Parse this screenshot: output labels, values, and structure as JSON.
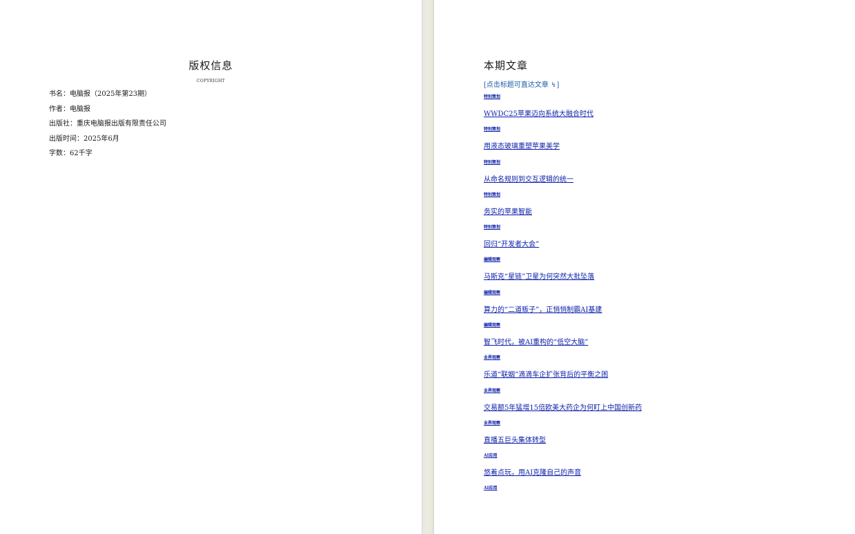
{
  "left_page": {
    "title": "版权信息",
    "subtitle": "COPYRIGHT",
    "info": [
      "书名：电脑报（2025年第23期）",
      "作者：电脑报",
      "出版社：重庆电脑报出版有限责任公司",
      "出版时间：2025年6月",
      "字数：62千字"
    ]
  },
  "right_page": {
    "title": "本期文章",
    "hint": "[点击标题可直达文章 ↯]",
    "entries": [
      {
        "category": "特别策划",
        "title": "WWDC25苹果迈向系统大融合时代"
      },
      {
        "category": "特别策划",
        "title": "用液态玻璃重塑苹果美学"
      },
      {
        "category": "特别策划",
        "title": "从命名规则到交互逻辑的统一"
      },
      {
        "category": "特别策划",
        "title": "务实的苹果智能"
      },
      {
        "category": "特别策划",
        "title": "回归“开发者大会”"
      },
      {
        "category": "编辑观察",
        "title": "马斯克“星链”卫星为何突然大批坠落"
      },
      {
        "category": "编辑观察",
        "title": "算力的“二道贩子”，正悄悄制霸AI基建"
      },
      {
        "category": "编辑观察",
        "title": "智飞时代，被AI重构的“低空大脑”"
      },
      {
        "category": "业界观察",
        "title": "乐道“联姻”滴滴车企扩张背后的平衡之困"
      },
      {
        "category": "业界观察",
        "title": "交易额5年猛增15倍欧美大药企为何盯上中国创新药"
      },
      {
        "category": "业界观察",
        "title": "直播五巨头集体转型"
      },
      {
        "category": "AI应用",
        "title": "悠着点玩，用AI克隆自己的声音"
      }
    ],
    "trailing_category": "AI应用"
  },
  "colors": {
    "link": "#0a1ea8",
    "hint": "#1d5da8",
    "gutter": "#e6e6da"
  }
}
